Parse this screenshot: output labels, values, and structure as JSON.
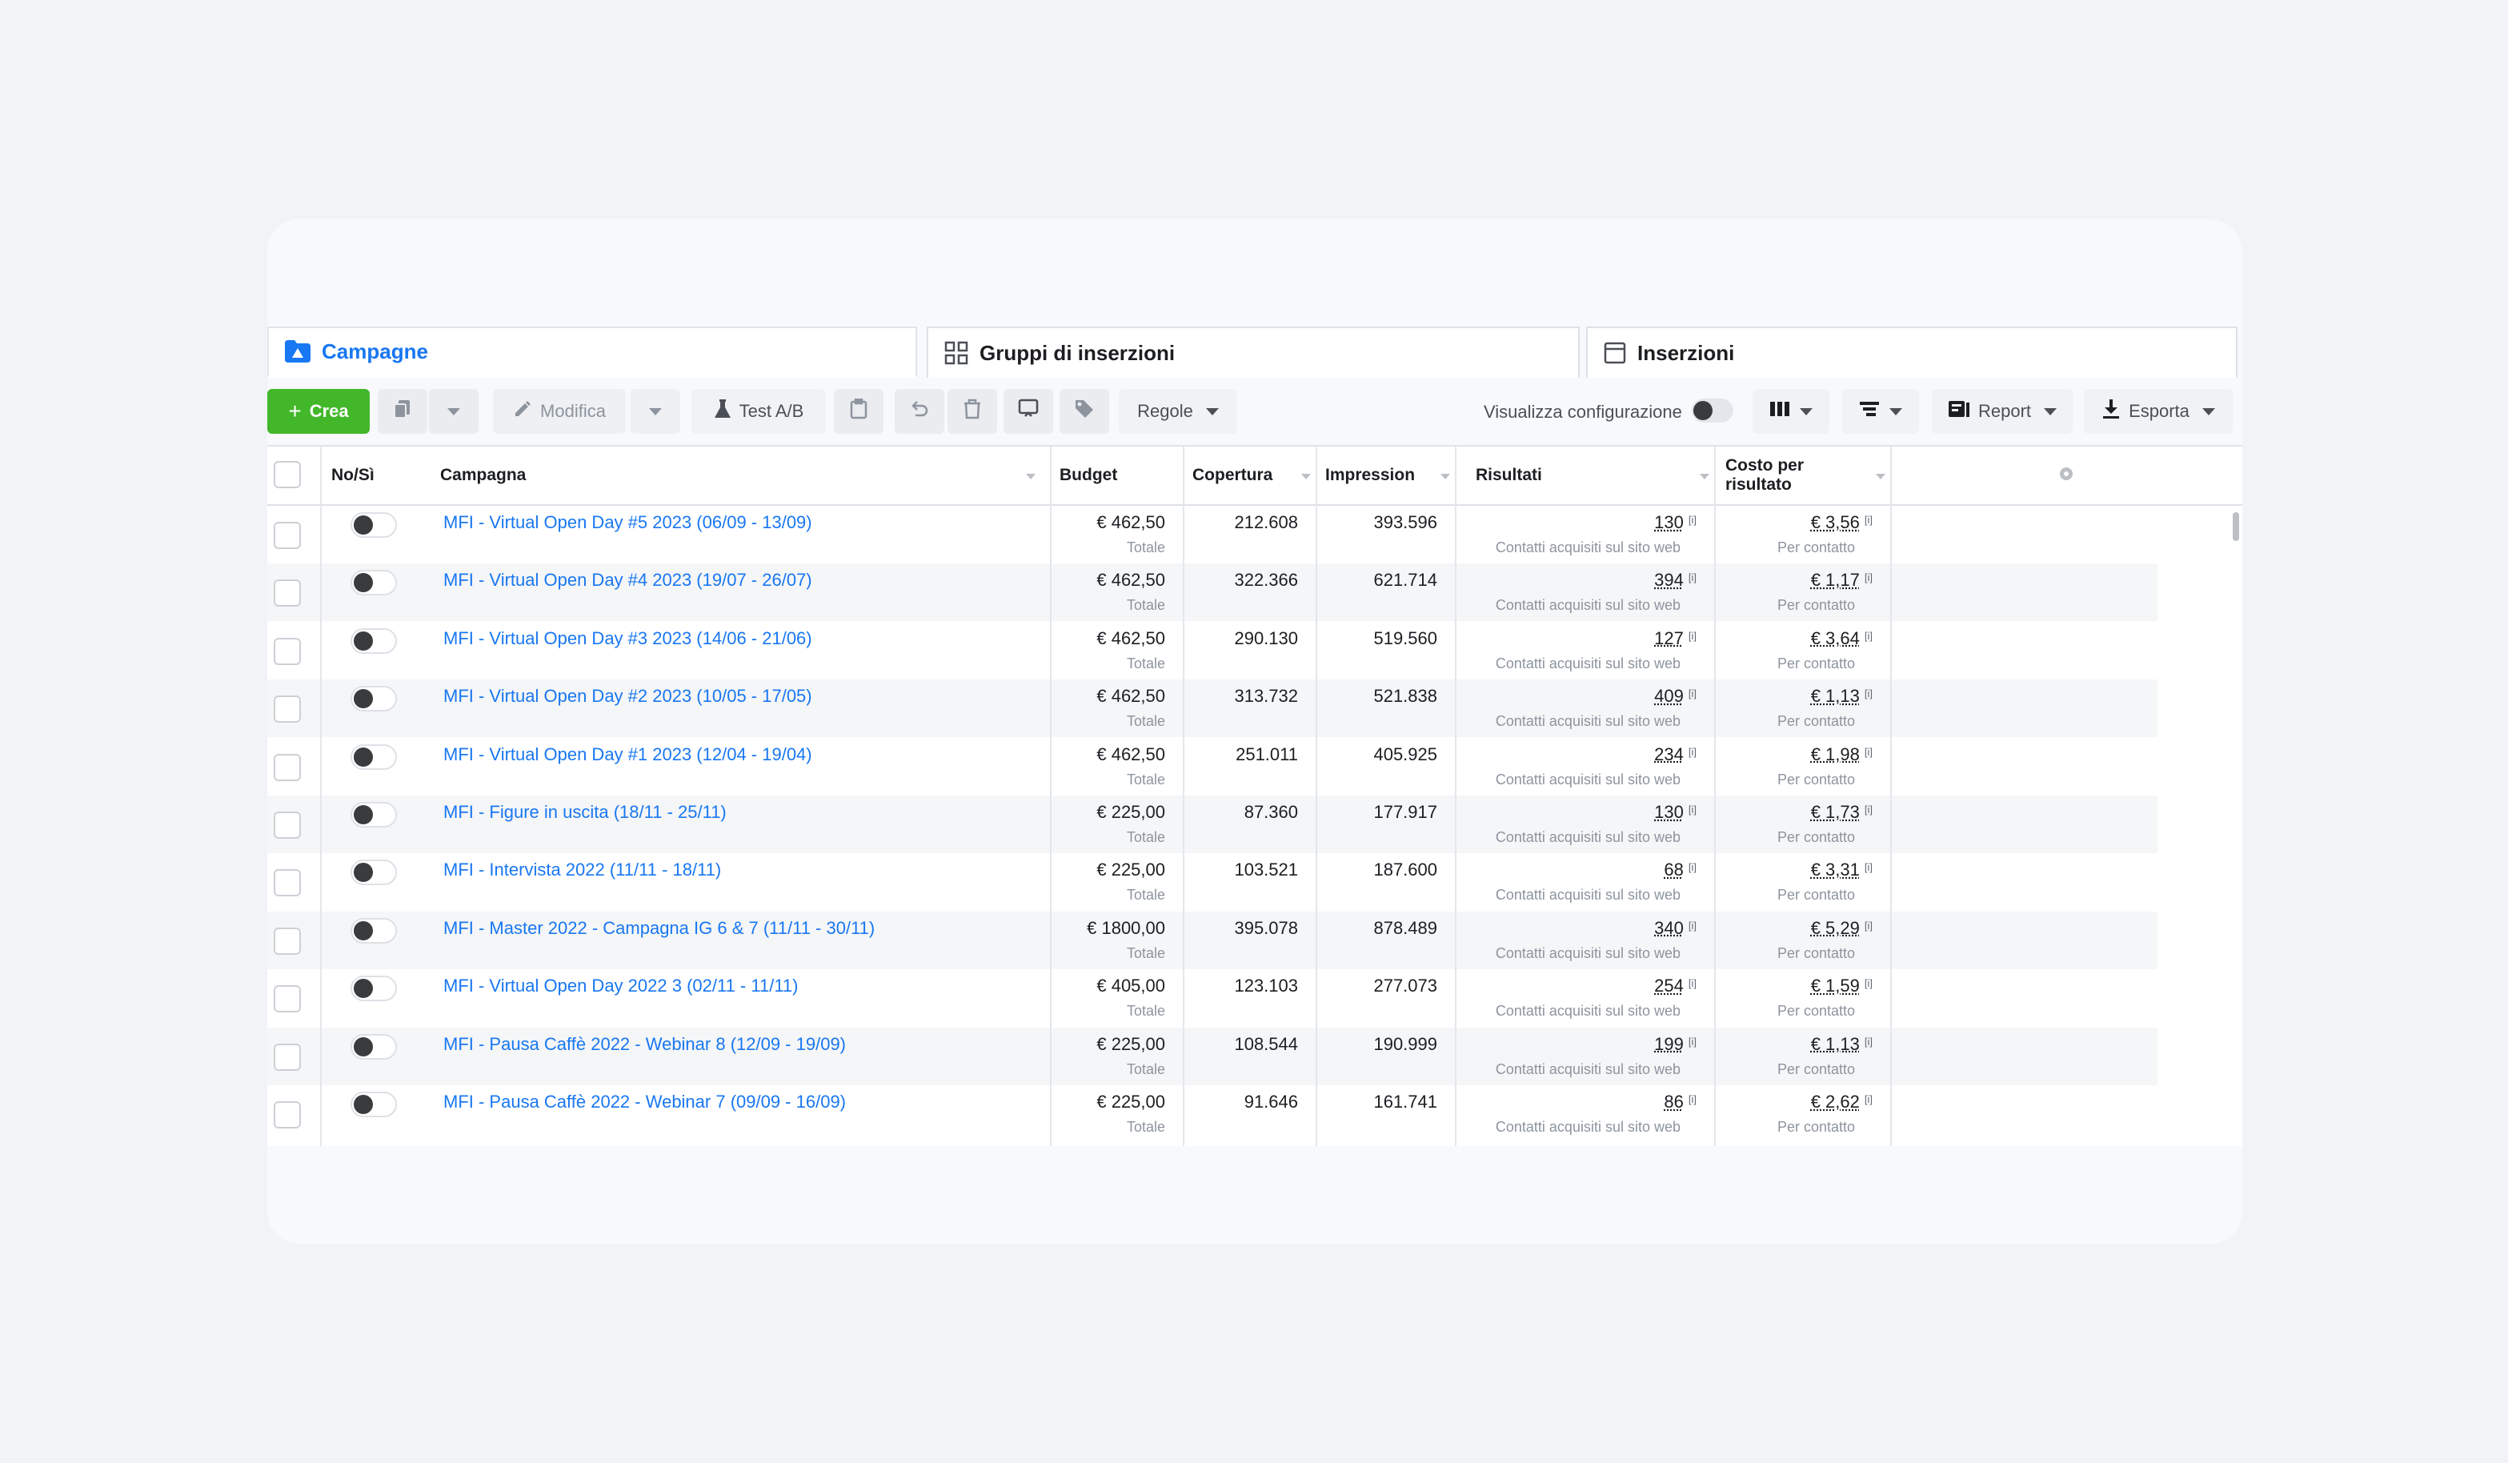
{
  "tabs": [
    {
      "label": "Campagne",
      "active": true
    },
    {
      "label": "Gruppi di inserzioni",
      "active": false
    },
    {
      "label": "Inserzioni",
      "active": false
    }
  ],
  "toolbar": {
    "create_label": "Crea",
    "edit_label": "Modifica",
    "ab_test_label": "Test A/B",
    "rules_label": "Regole",
    "view_config_label": "Visualizza configurazione",
    "report_label": "Report",
    "export_label": "Esporta"
  },
  "columns": {
    "onoff": "No/Sì",
    "campaign": "Campagna",
    "budget": "Budget",
    "reach": "Copertura",
    "impressions": "Impression",
    "results": "Risultati",
    "cost_line1": "Costo per",
    "cost_line2": "risultato"
  },
  "rows": [
    {
      "name": "MFI - Virtual Open Day #5 2023 (06/09 - 13/09)",
      "budget": "€ 462,50",
      "budget_sub": "Totale",
      "reach": "212.608",
      "impressions": "393.596",
      "results": "130",
      "results_sub": "Contatti acquisiti sul sito web",
      "cost": "€ 3,56",
      "cost_sub": "Per contatto"
    },
    {
      "name": "MFI - Virtual Open Day #4 2023 (19/07 - 26/07)",
      "budget": "€ 462,50",
      "budget_sub": "Totale",
      "reach": "322.366",
      "impressions": "621.714",
      "results": "394",
      "results_sub": "Contatti acquisiti sul sito web",
      "cost": "€ 1,17",
      "cost_sub": "Per contatto"
    },
    {
      "name": "MFI - Virtual Open Day #3 2023 (14/06 - 21/06)",
      "budget": "€ 462,50",
      "budget_sub": "Totale",
      "reach": "290.130",
      "impressions": "519.560",
      "results": "127",
      "results_sub": "Contatti acquisiti sul sito web",
      "cost": "€ 3,64",
      "cost_sub": "Per contatto"
    },
    {
      "name": "MFI - Virtual Open Day #2 2023 (10/05 - 17/05)",
      "budget": "€ 462,50",
      "budget_sub": "Totale",
      "reach": "313.732",
      "impressions": "521.838",
      "results": "409",
      "results_sub": "Contatti acquisiti sul sito web",
      "cost": "€ 1,13",
      "cost_sub": "Per contatto"
    },
    {
      "name": "MFI - Virtual Open Day #1 2023 (12/04 - 19/04)",
      "budget": "€ 462,50",
      "budget_sub": "Totale",
      "reach": "251.011",
      "impressions": "405.925",
      "results": "234",
      "results_sub": "Contatti acquisiti sul sito web",
      "cost": "€ 1,98",
      "cost_sub": "Per contatto"
    },
    {
      "name": "MFI - Figure in uscita (18/11 - 25/11)",
      "budget": "€ 225,00",
      "budget_sub": "Totale",
      "reach": "87.360",
      "impressions": "177.917",
      "results": "130",
      "results_sub": "Contatti acquisiti sul sito web",
      "cost": "€ 1,73",
      "cost_sub": "Per contatto"
    },
    {
      "name": "MFI - Intervista 2022 (11/11 - 18/11)",
      "budget": "€ 225,00",
      "budget_sub": "Totale",
      "reach": "103.521",
      "impressions": "187.600",
      "results": "68",
      "results_sub": "Contatti acquisiti sul sito web",
      "cost": "€ 3,31",
      "cost_sub": "Per contatto"
    },
    {
      "name": "MFI - Master 2022 - Campagna IG 6 & 7 (11/11 - 30/11)",
      "budget": "€ 1800,00",
      "budget_sub": "Totale",
      "reach": "395.078",
      "impressions": "878.489",
      "results": "340",
      "results_sub": "Contatti acquisiti sul sito web",
      "cost": "€ 5,29",
      "cost_sub": "Per contatto"
    },
    {
      "name": "MFI - Virtual Open Day 2022 3 (02/11 - 11/11)",
      "budget": "€ 405,00",
      "budget_sub": "Totale",
      "reach": "123.103",
      "impressions": "277.073",
      "results": "254",
      "results_sub": "Contatti acquisiti sul sito web",
      "cost": "€ 1,59",
      "cost_sub": "Per contatto"
    },
    {
      "name": "MFI - Pausa Caffè 2022 - Webinar 8 (12/09 - 19/09)",
      "budget": "€ 225,00",
      "budget_sub": "Totale",
      "reach": "108.544",
      "impressions": "190.999",
      "results": "199",
      "results_sub": "Contatti acquisiti sul sito web",
      "cost": "€ 1,13",
      "cost_sub": "Per contatto"
    },
    {
      "name": "MFI - Pausa Caffè 2022 - Webinar 7 (09/09 - 16/09)",
      "budget": "€ 225,00",
      "budget_sub": "Totale",
      "reach": "91.646",
      "impressions": "161.741",
      "results": "86",
      "results_sub": "Contatti acquisiti sul sito web",
      "cost": "€ 2,62",
      "cost_sub": "Per contatto"
    }
  ],
  "info_marker": "[i]",
  "colors": {
    "accent": "#1877f2",
    "create_button": "#42b72a",
    "background": "#f1f3f7"
  }
}
